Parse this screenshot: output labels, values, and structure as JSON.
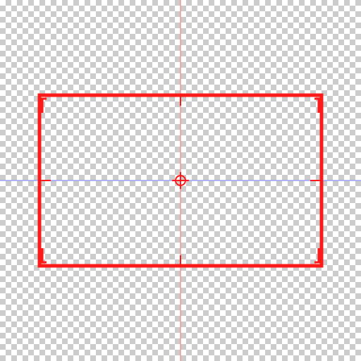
{
  "canvas": {
    "background": "checkerboard-transparency",
    "checker_colors": [
      "#ffffff",
      "#cccccc"
    ]
  },
  "guides": {
    "vertical_color": "#ff6b6b",
    "horizontal_color": "#7b7bff"
  },
  "frame": {
    "color": "#ff1a1a",
    "style": "rectangle-with-corner-ticks"
  },
  "center_marker": {
    "icon": "crosshair-circle-icon",
    "color": "#ff1a1a"
  }
}
